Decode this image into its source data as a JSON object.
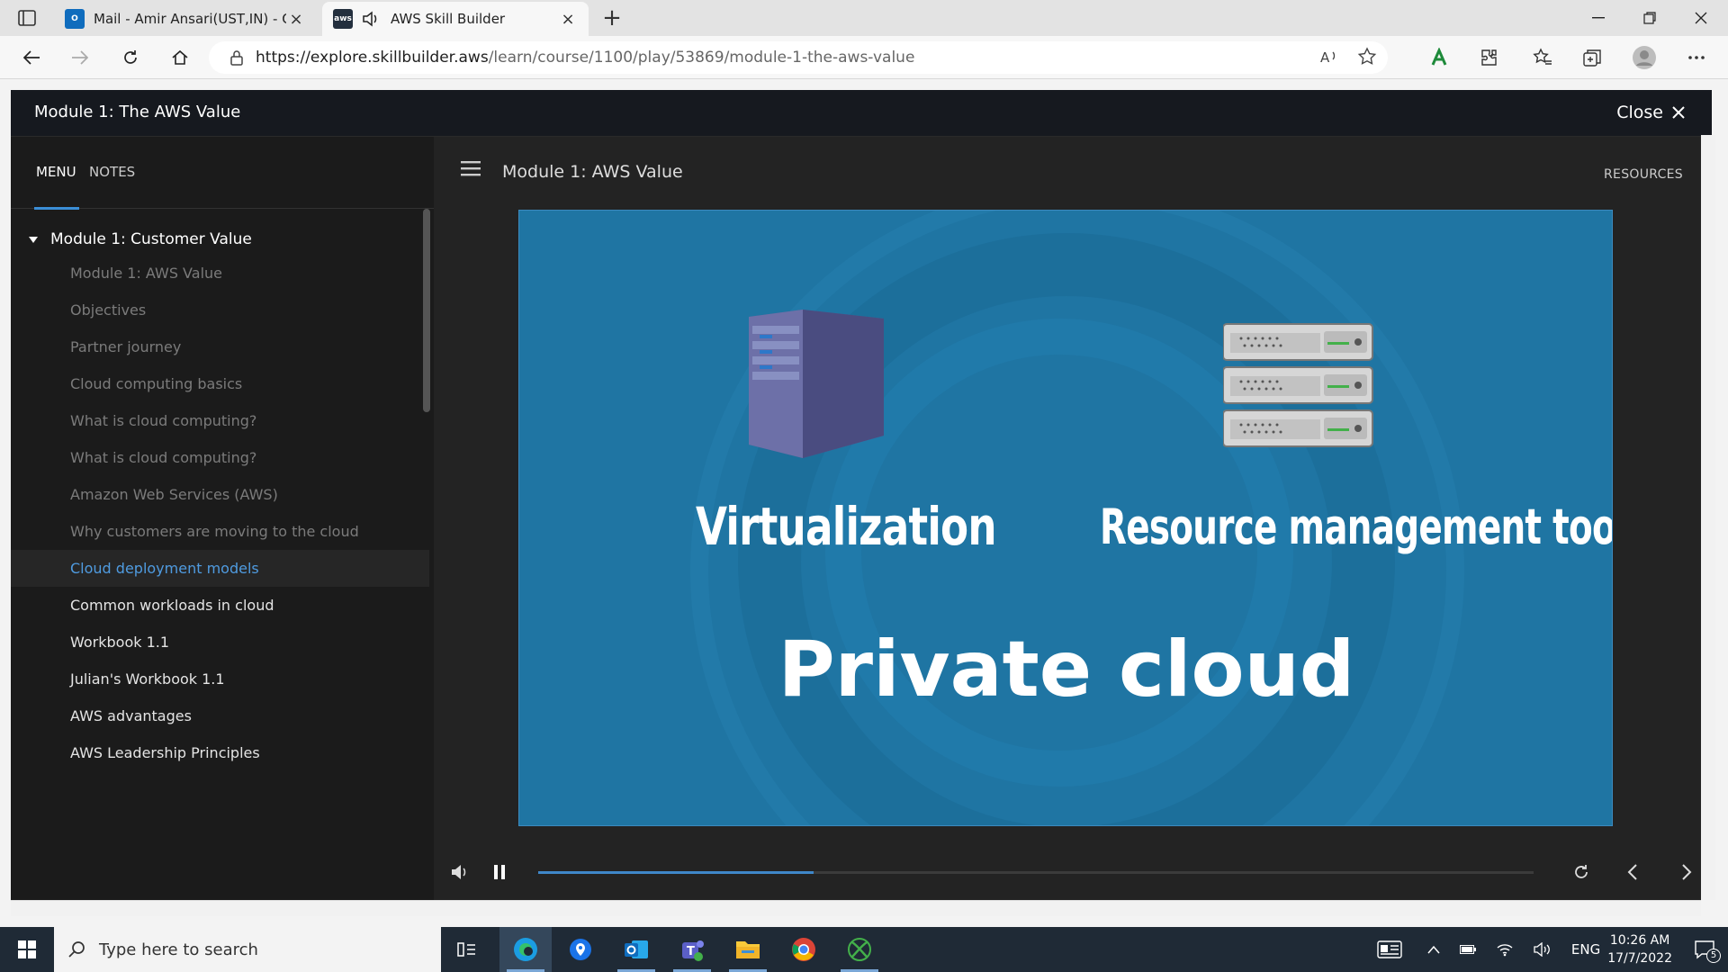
{
  "browser": {
    "tabs": [
      {
        "title": "Mail - Amir Ansari(UST,IN) - Outl",
        "favicon": "outlook-icon"
      },
      {
        "title": "AWS Skill Builder",
        "favicon": "aws-icon",
        "audio": true
      }
    ],
    "url_host": "https://explore.skillbuilder.aws",
    "url_path": "/learn/course/1100/play/53869/module-1-the-aws-value"
  },
  "player": {
    "title": "Module 1: The AWS Value",
    "close_label": "Close",
    "sidebar": {
      "tabs": [
        "MENU",
        "NOTES"
      ],
      "section_title": "Module 1: Customer Value",
      "items": [
        {
          "label": "Module 1: AWS Value",
          "state": "done"
        },
        {
          "label": "Objectives",
          "state": "done"
        },
        {
          "label": "Partner journey",
          "state": "done"
        },
        {
          "label": "Cloud computing basics",
          "state": "done"
        },
        {
          "label": "What is cloud computing?",
          "state": "done"
        },
        {
          "label": "What is cloud computing?",
          "state": "done"
        },
        {
          "label": "Amazon Web Services (AWS)",
          "state": "done"
        },
        {
          "label": "Why customers are moving to the cloud",
          "state": "done"
        },
        {
          "label": "Cloud deployment models",
          "state": "active"
        },
        {
          "label": "Common workloads in cloud",
          "state": "todo"
        },
        {
          "label": "Workbook 1.1",
          "state": "todo"
        },
        {
          "label": "Julian's Workbook 1.1",
          "state": "todo"
        },
        {
          "label": "AWS advantages",
          "state": "todo"
        },
        {
          "label": "AWS Leadership Principles",
          "state": "todo"
        }
      ]
    },
    "content": {
      "title": "Module 1: AWS Value",
      "resources_label": "RESOURCES",
      "slide": {
        "virtualization": "Virtualization",
        "resource_tools": "Resource management tools",
        "headline": "Private cloud"
      },
      "progress": 0.277
    }
  },
  "taskbar": {
    "search_placeholder": "Type here to search",
    "language": "ENG",
    "time": "10:26 AM",
    "date": "17/7/2022",
    "notifications": "5"
  },
  "colors": {
    "accent": "#3f87c9",
    "slide_bg": "#1f75a3",
    "active_item": "#4f9be0"
  }
}
